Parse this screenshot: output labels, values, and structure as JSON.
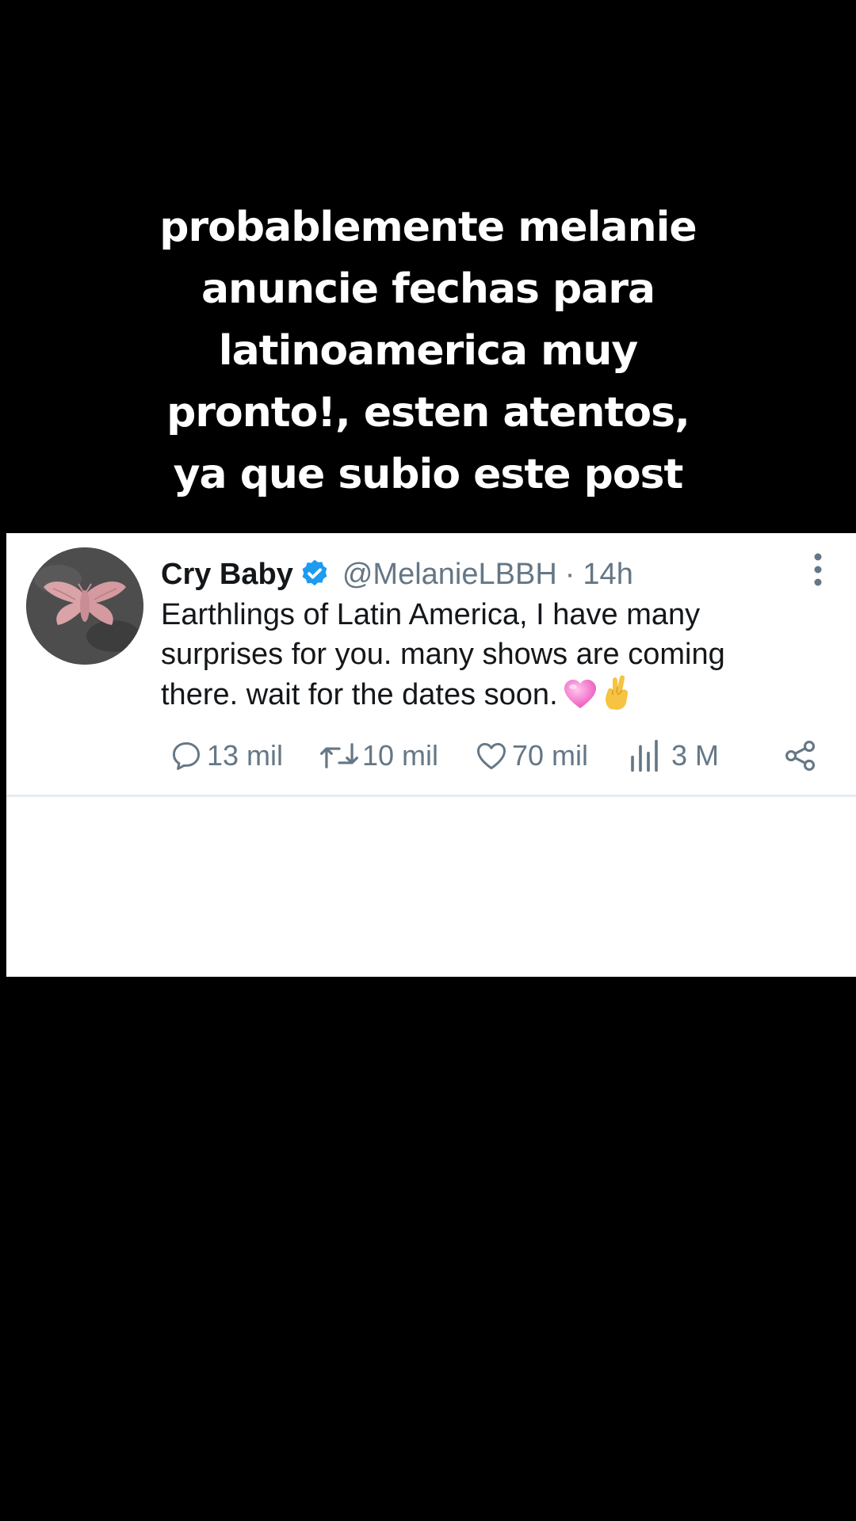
{
  "caption": {
    "lines": [
      "probablemente melanie",
      "anuncie fechas para",
      "latinoamerica muy",
      "pronto!, esten atentos,",
      "ya que subio este post"
    ]
  },
  "tweet": {
    "display_name": "Cry Baby",
    "verified": true,
    "handle": "@MelanieLBBH",
    "separator": "·",
    "time": "14h",
    "text_lines": [
      "Earthlings of Latin America, I have many",
      "surprises for you. many shows are coming",
      "there. wait for the dates soon."
    ],
    "emojis": [
      "pink-heart-icon",
      "crossed-fingers-icon"
    ],
    "actions": {
      "replies": "13 mil",
      "retweets": "10 mil",
      "likes": "70 mil",
      "views": "3 M"
    },
    "colors": {
      "text": "#14171a",
      "secondary": "#657786",
      "verified_blue": "#1d9bf0",
      "card_bg": "#ffffff",
      "page_bg": "#000000"
    }
  }
}
